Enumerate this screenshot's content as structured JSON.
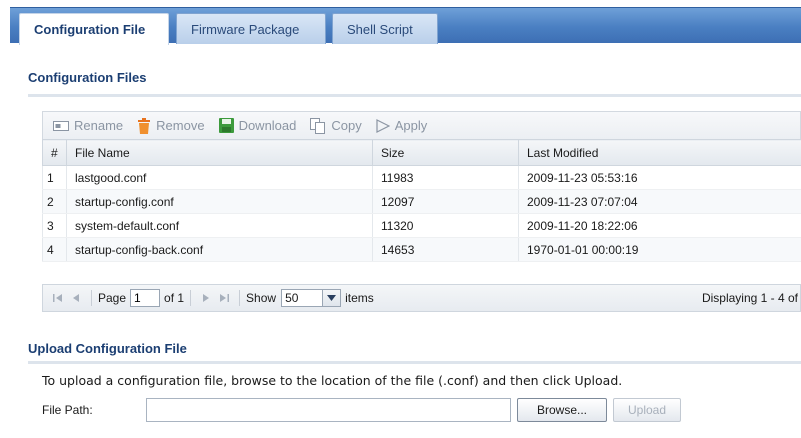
{
  "tabs": [
    {
      "label": "Configuration File"
    },
    {
      "label": "Firmware Package"
    },
    {
      "label": "Shell Script"
    }
  ],
  "config_section": {
    "title": "Configuration Files"
  },
  "toolbar": {
    "rename_label": "Rename",
    "remove_label": "Remove",
    "download_label": "Download",
    "copy_label": "Copy",
    "apply_label": "Apply"
  },
  "table": {
    "headers": [
      "#",
      "File Name",
      "Size",
      "Last Modified"
    ],
    "rows": [
      {
        "num": "1",
        "name": "lastgood.conf",
        "size": "11983",
        "modified": "2009-11-23 05:53:16"
      },
      {
        "num": "2",
        "name": "startup-config.conf",
        "size": "12097",
        "modified": "2009-11-23 07:07:04"
      },
      {
        "num": "3",
        "name": "system-default.conf",
        "size": "11320",
        "modified": "2009-11-20 18:22:06"
      },
      {
        "num": "4",
        "name": "startup-config-back.conf",
        "size": "14653",
        "modified": "1970-01-01 00:00:19"
      }
    ]
  },
  "pager": {
    "page_label": "Page",
    "page_value": "1",
    "of_label": "of 1",
    "show_label": "Show",
    "show_value": "50",
    "items_label": "items",
    "displaying": "Displaying 1 - 4 of"
  },
  "upload_section": {
    "title": "Upload Configuration File",
    "description": "To upload a configuration file, browse to the location of the file (.conf) and then click Upload.",
    "file_path_label": "File Path:",
    "browse_label": "Browse...",
    "upload_label": "Upload"
  },
  "colors": {
    "tab_bar": "#4a7fc2",
    "section_title": "#1b3e72",
    "remove_icon": "#e8731e",
    "download_icon": "#3c9a3c"
  }
}
